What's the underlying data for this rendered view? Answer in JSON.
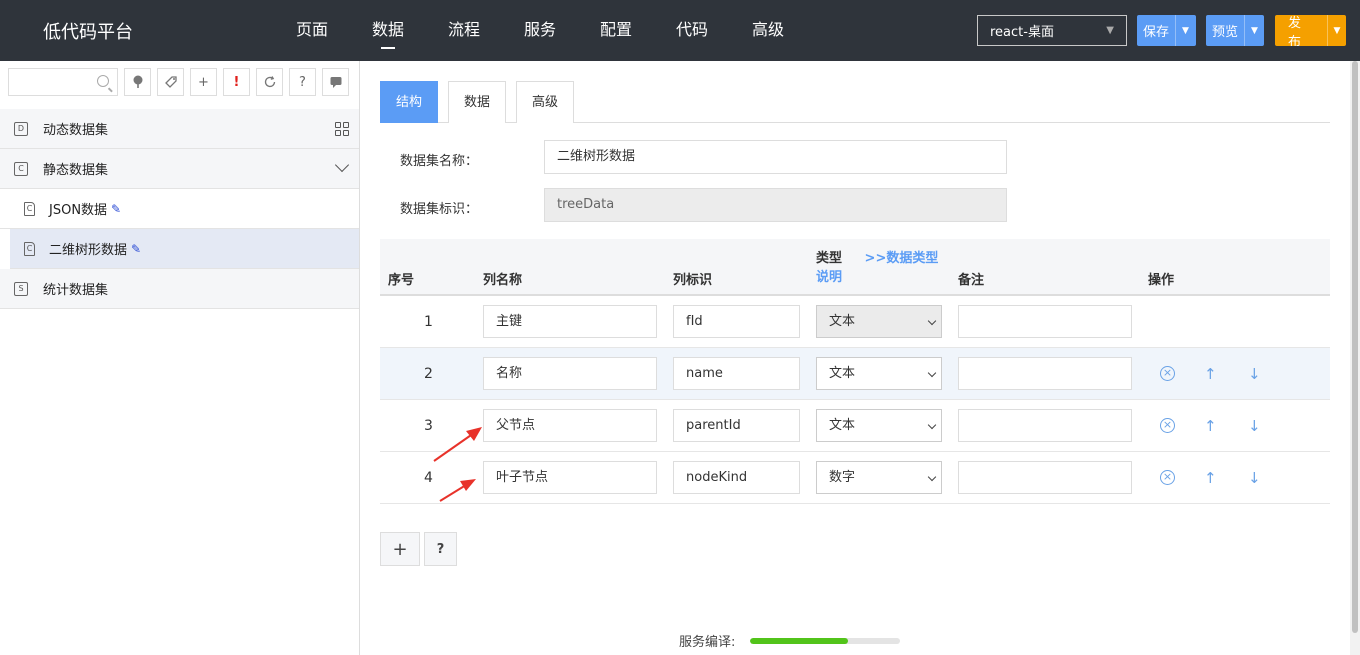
{
  "app": {
    "brand": "低代码平台"
  },
  "nav": {
    "items": [
      "页面",
      "数据",
      "流程",
      "服务",
      "配置",
      "代码",
      "高级"
    ],
    "active_index": 1
  },
  "header": {
    "env_select": "react-桌面",
    "save_label": "保存",
    "preview_label": "预览",
    "publish_label": "发布"
  },
  "sidebar": {
    "tools": [
      "tree-icon",
      "tag-icon",
      "plus-icon",
      "exclamation-icon",
      "refresh-icon",
      "question-icon",
      "comment-icon"
    ],
    "tool_glyphs": {
      "plus": "+",
      "exclamation": "!",
      "question": "?"
    },
    "dynamic": {
      "label": "动态数据集",
      "badge": "D"
    },
    "static": {
      "label": "静态数据集",
      "badge": "C"
    },
    "items": [
      {
        "label": "JSON数据",
        "badge": "C"
      },
      {
        "label": "二维树形数据",
        "badge": "C",
        "selected": true
      }
    ],
    "stats": {
      "label": "统计数据集",
      "badge": "S"
    }
  },
  "main": {
    "tabs": [
      "结构",
      "数据",
      "高级"
    ],
    "active_tab": 0,
    "form": {
      "name_label": "数据集名称：",
      "name_value": "二维树形数据",
      "id_label": "数据集标识：",
      "id_value": "treeData"
    },
    "table": {
      "headers": {
        "index": "序号",
        "name": "列名称",
        "key": "列标识",
        "type": "类型",
        "type_link": ">>数据类型",
        "type_desc": "说明",
        "note": "备注",
        "ops": "操作"
      },
      "rows": [
        {
          "index": "1",
          "name": "主键",
          "key": "fId",
          "type": "文本",
          "note": "",
          "disabled": true,
          "ops": false
        },
        {
          "index": "2",
          "name": "名称",
          "key": "name",
          "type": "文本",
          "note": "",
          "disabled": false,
          "ops": true,
          "highlight": true
        },
        {
          "index": "3",
          "name": "父节点",
          "key": "parentId",
          "type": "文本",
          "note": "",
          "disabled": false,
          "ops": true
        },
        {
          "index": "4",
          "name": "叶子节点",
          "key": "nodeKind",
          "type": "数字",
          "note": "",
          "disabled": false,
          "ops": true
        }
      ],
      "op_glyphs": {
        "delete": "×",
        "up": "↑",
        "down": "↓"
      }
    },
    "add_glyph": "+",
    "help_glyph": "?",
    "compile": {
      "label": "服务编译:",
      "progress": 0.65
    }
  },
  "colors": {
    "topbar": "#2f343b",
    "primary": "#5b9cf5",
    "publish": "#f5a000",
    "progress": "#52c41a",
    "annotation": "#e8322a"
  }
}
